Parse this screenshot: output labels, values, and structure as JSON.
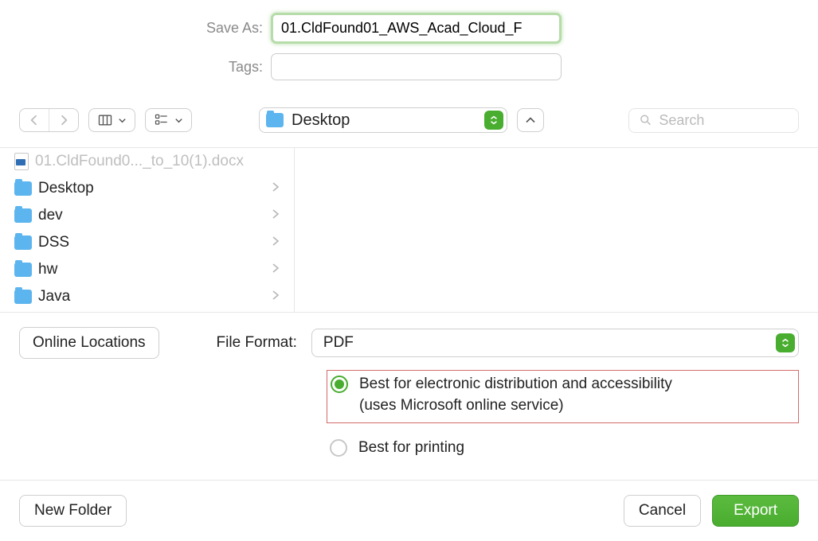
{
  "saveAs": {
    "label": "Save As:",
    "value": "01.CldFound01_AWS_Acad_Cloud_F"
  },
  "tags": {
    "label": "Tags:",
    "value": ""
  },
  "toolbar": {
    "location": "Desktop",
    "search": {
      "placeholder": "Search"
    }
  },
  "browser": {
    "items": [
      {
        "type": "doc",
        "name": "01.CldFound0..._to_10(1).docx",
        "hasChildren": false,
        "greyed": true
      },
      {
        "type": "folder",
        "name": "Desktop",
        "hasChildren": true
      },
      {
        "type": "folder",
        "name": "dev",
        "hasChildren": true
      },
      {
        "type": "folder",
        "name": "DSS",
        "hasChildren": true
      },
      {
        "type": "folder",
        "name": "hw",
        "hasChildren": true
      },
      {
        "type": "folder",
        "name": "Java",
        "hasChildren": true
      }
    ]
  },
  "format": {
    "onlineLocationsLabel": "Online Locations",
    "label": "File Format:",
    "selected": "PDF",
    "options": [
      {
        "selected": true,
        "label_line1": "Best for electronic distribution and accessibility",
        "label_line2": "(uses Microsoft online service)"
      },
      {
        "selected": false,
        "label_line1": "Best for printing",
        "label_line2": ""
      }
    ]
  },
  "footer": {
    "newFolder": "New Folder",
    "cancel": "Cancel",
    "export": "Export"
  }
}
